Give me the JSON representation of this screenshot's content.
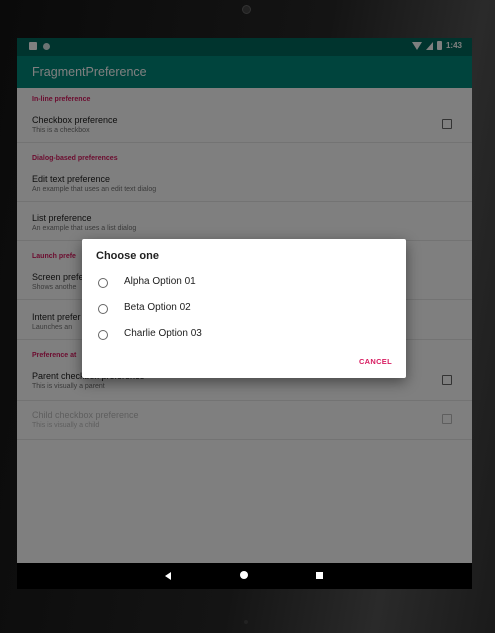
{
  "status_bar": {
    "time": "1:43"
  },
  "app_bar": {
    "title": "FragmentPreference"
  },
  "preferences": {
    "inline_category": "In-line preference",
    "checkbox": {
      "title": "Checkbox preference",
      "summary": "This is a checkbox"
    },
    "dialog_category": "Dialog-based preferences",
    "edit_text": {
      "title": "Edit text preference",
      "summary": "An example that uses an edit text dialog"
    },
    "list": {
      "title": "List preference",
      "summary": "An example that uses a list dialog"
    },
    "launch_category": "Launch prefe",
    "screen": {
      "title": "Screen prefe",
      "summary": "Shows anothe"
    },
    "intent": {
      "title": "Intent prefer",
      "summary": "Launches an"
    },
    "attributes_category": "Preference at",
    "parent": {
      "title": "Parent checkbox preference",
      "summary": "This is visually a parent"
    },
    "child": {
      "title": "Child checkbox preference",
      "summary": "This is visually a child"
    }
  },
  "dialog": {
    "title": "Choose one",
    "options": [
      {
        "label": "Alpha Option 01"
      },
      {
        "label": "Beta Option 02"
      },
      {
        "label": "Charlie Option 03"
      }
    ],
    "cancel_label": "CANCEL"
  },
  "colors": {
    "primary": "#00897b",
    "primary_dark": "#00695c",
    "accent": "#d81b60"
  },
  "icons": [
    "back-icon",
    "home-icon",
    "recents-icon",
    "wifi-icon",
    "signal-icon",
    "battery-icon"
  ]
}
